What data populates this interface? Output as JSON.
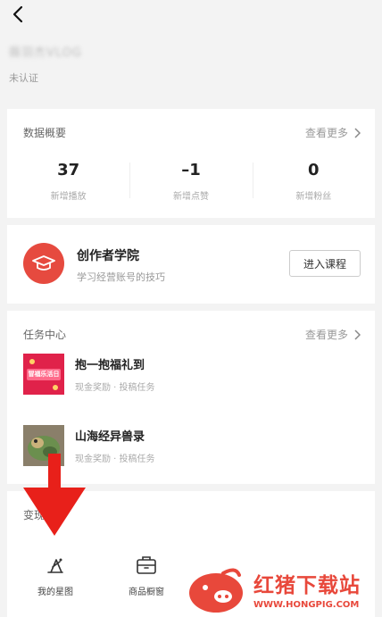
{
  "profile": {
    "name": "薇羽杰VLOG",
    "status": "未认证"
  },
  "overview": {
    "title": "数据概要",
    "more": "查看更多",
    "stats": [
      {
        "value": "37",
        "label": "新增播放"
      },
      {
        "value": "–1",
        "label": "新增点赞"
      },
      {
        "value": "0",
        "label": "新增粉丝"
      }
    ]
  },
  "academy": {
    "title": "创作者学院",
    "subtitle": "学习经营账号的技巧",
    "button": "进入课程"
  },
  "tasks": {
    "title": "任务中心",
    "more": "查看更多",
    "items": [
      {
        "title": "抱一抱福礼到",
        "subtitle": "现金奖励 · 投稿任务",
        "thumb_text": "冒福乐活日"
      },
      {
        "title": "山海经异兽录",
        "subtitle": "现金奖励 · 投稿任务"
      }
    ]
  },
  "tools": {
    "title": "变现",
    "items": [
      {
        "label": "我的星图",
        "icon": "star-map-icon"
      },
      {
        "label": "商品橱窗",
        "icon": "shop-window-icon"
      }
    ]
  },
  "watermark": {
    "name": "红猪下载站",
    "url": "WWW.HONGPIG.COM"
  },
  "colors": {
    "accent": "#e64a3f",
    "arrow": "#e8201a",
    "watermark": "#e8483b"
  }
}
